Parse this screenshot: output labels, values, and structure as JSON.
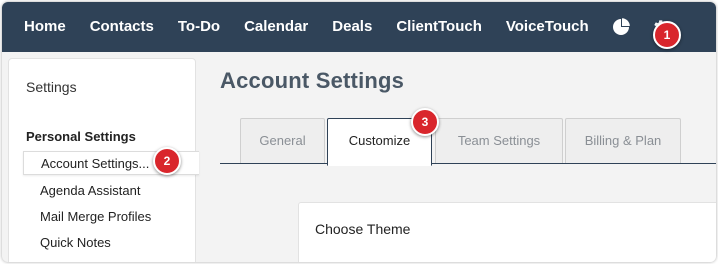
{
  "nav": {
    "items": [
      {
        "label": "Home"
      },
      {
        "label": "Contacts"
      },
      {
        "label": "To-Do"
      },
      {
        "label": "Calendar"
      },
      {
        "label": "Deals"
      },
      {
        "label": "ClientTouch"
      },
      {
        "label": "VoiceTouch"
      }
    ],
    "icons": [
      "pie-chart-icon",
      "gear-icon"
    ],
    "bg_color": "#2f4257"
  },
  "sidebar": {
    "title": "Settings",
    "section": "Personal Settings",
    "items": [
      {
        "label": "Account Settings...",
        "active": true
      },
      {
        "label": "Agenda Assistant"
      },
      {
        "label": "Mail Merge Profiles"
      },
      {
        "label": "Quick Notes"
      }
    ]
  },
  "main": {
    "title": "Account Settings",
    "tabs": [
      {
        "label": "General"
      },
      {
        "label": "Customize",
        "active": true
      },
      {
        "label": "Team Settings"
      },
      {
        "label": "Billing & Plan"
      }
    ],
    "panel_title": "Choose Theme"
  },
  "callouts": [
    "1",
    "2",
    "3"
  ],
  "callout_color": "#d9262c"
}
